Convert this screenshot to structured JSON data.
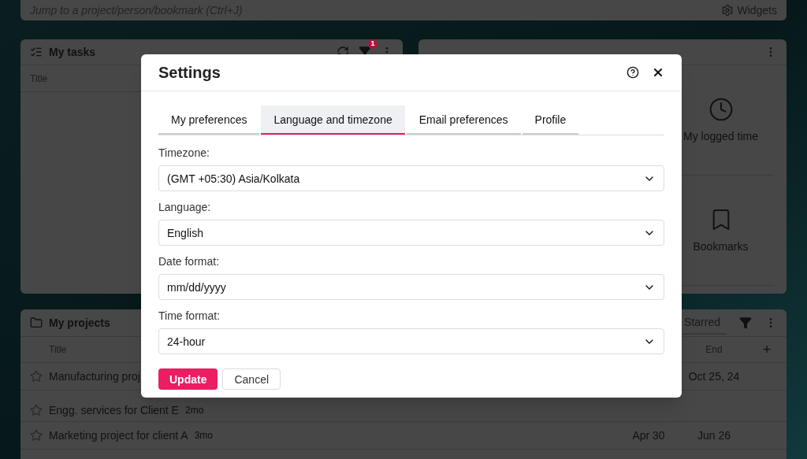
{
  "search": {
    "placeholder": "Jump to a project/person/bookmark (Ctrl+J)"
  },
  "widgets_button": "Widgets",
  "tasks_panel": {
    "title": "My tasks",
    "filter_badge": "1",
    "columns": [
      "Title"
    ]
  },
  "shortcuts_panel": {
    "items": [
      {
        "kind": "clock",
        "label": "My logged time"
      },
      {
        "kind": "bookmark",
        "label": "Bookmarks"
      }
    ]
  },
  "projects_panel": {
    "title": "My projects",
    "tabs": [
      {
        "label": "Starred",
        "selected": false
      }
    ],
    "columns": [
      "Title",
      "End"
    ],
    "add_column": "+",
    "rows": [
      {
        "title": "Manufacturing proj",
        "age": "",
        "start": "",
        "end": "Oct 25, 24"
      },
      {
        "title": "Engg. services for Client E",
        "age": "2mo",
        "start": "",
        "end": ""
      },
      {
        "title": "Marketing project for client A",
        "age": "3mo",
        "start": "Apr 30",
        "end": "Jun 26"
      }
    ]
  },
  "dialog": {
    "title": "Settings",
    "tabs": [
      {
        "label": "My preferences",
        "selected": false
      },
      {
        "label": "Language and timezone",
        "selected": true
      },
      {
        "label": "Email preferences",
        "selected": false
      },
      {
        "label": "Profile",
        "selected": false
      }
    ],
    "fields": [
      {
        "label": "Timezone:",
        "value": "(GMT +05:30) Asia/Kolkata"
      },
      {
        "label": "Language:",
        "value": "English"
      },
      {
        "label": "Date format:",
        "value": "mm/dd/yyyy"
      },
      {
        "label": "Time format:",
        "value": "24-hour"
      }
    ],
    "buttons": [
      {
        "kind": "primary",
        "label": "Update"
      },
      {
        "kind": "secondary",
        "label": "Cancel"
      }
    ]
  }
}
